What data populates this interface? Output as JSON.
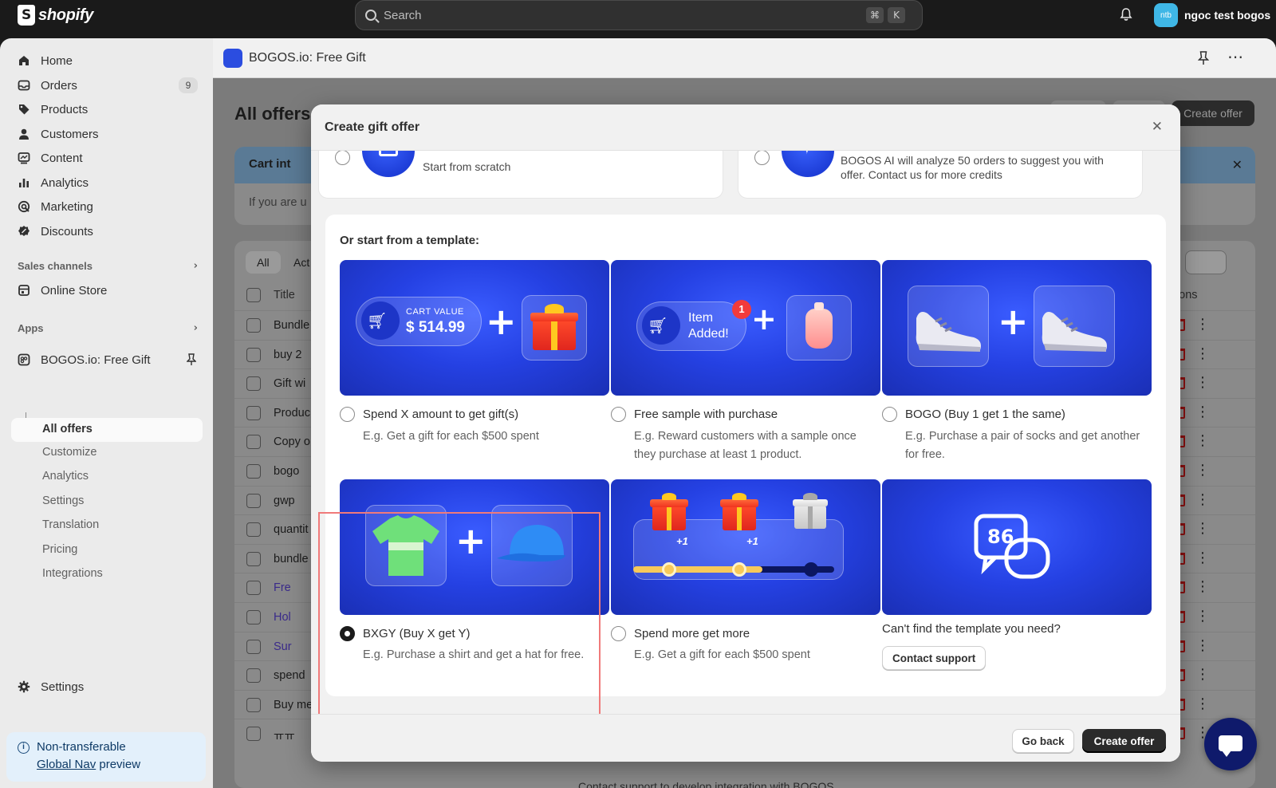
{
  "topbar": {
    "brand": "shopify",
    "search_placeholder": "Search",
    "shortcut_keys": [
      "⌘",
      "K"
    ],
    "user_initials": "ntb",
    "user_name": "ngoc test bogos"
  },
  "sidebar": {
    "items": [
      {
        "label": "Home",
        "icon": "home-icon"
      },
      {
        "label": "Orders",
        "icon": "orders-icon",
        "badge": "9"
      },
      {
        "label": "Products",
        "icon": "tag-icon"
      },
      {
        "label": "Customers",
        "icon": "person-icon"
      },
      {
        "label": "Content",
        "icon": "content-icon"
      },
      {
        "label": "Analytics",
        "icon": "bar-chart-icon"
      },
      {
        "label": "Marketing",
        "icon": "target-icon"
      },
      {
        "label": "Discounts",
        "icon": "discount-icon"
      }
    ],
    "sales_channels_title": "Sales channels",
    "online_store": "Online Store",
    "apps_title": "Apps",
    "app_name": "BOGOS.io: Free Gift",
    "app_subitems": [
      "All offers",
      "Customize",
      "Analytics",
      "Settings",
      "Translation",
      "Pricing",
      "Integrations"
    ],
    "settings": "Settings",
    "preview_line1": "Non-transferable",
    "preview_link": "Global Nav",
    "preview_suffix": "preview"
  },
  "app_header": {
    "title": "BOGOS.io: Free Gift"
  },
  "background": {
    "page_title": "All offers",
    "create_offer": "Create offer",
    "banner_title": "Cart int",
    "banner_text": "If you are u",
    "tabs": [
      "All",
      "Act"
    ],
    "table_title_header": "Title",
    "actions_header": "Actions",
    "rows": [
      "Bundle",
      "buy 2",
      "Gift wi",
      "Produc",
      "Copy o",
      "bogo",
      "gwp",
      "quantit",
      "bundle",
      "Fre",
      "Hol",
      "Sur",
      "spend",
      "Buy me",
      "ㅠㅠ"
    ],
    "footer_text": "Contact support to develop integration with BOGOS"
  },
  "modal": {
    "title": "Create gift offer",
    "scratch_desc": "Start from scratch",
    "ai_desc": "BOGOS AI will analyze 50 orders to suggest you with offer. Contact us for more credits",
    "template_heading": "Or start from a template:",
    "templates": [
      {
        "label": "Spend X amount to get gift(s)",
        "desc": "E.g. Get a gift for each $500 spent",
        "selected": false
      },
      {
        "label": "Free sample with purchase",
        "desc": "E.g. Reward customers with a sample once they purchase at least 1 product.",
        "selected": false
      },
      {
        "label": "BOGO (Buy 1 get 1 the same)",
        "desc": "E.g. Purchase a pair of socks and get another for free.",
        "selected": false
      },
      {
        "label": "BXGY (Buy X get Y)",
        "desc": "E.g. Purchase a shirt and get a hat for free.",
        "selected": true
      },
      {
        "label": "Spend more get more",
        "desc": "E.g. Get a gift for each $500 spent",
        "selected": false
      }
    ],
    "illustrations": {
      "cart_value_label": "CART VALUE",
      "cart_value_amount": "$ 514.99",
      "item_added_line1": "Item",
      "item_added_line2": "Added!",
      "item_count": "1",
      "plus_one": "+1"
    },
    "cant_find": "Can't find the template you need?",
    "contact_support": "Contact support",
    "go_back": "Go back",
    "create_offer": "Create offer"
  },
  "colors": {
    "accent_blue": "#2541e3",
    "highlight_red": "#f07a7a",
    "primary_button": "#2b2b2b"
  }
}
